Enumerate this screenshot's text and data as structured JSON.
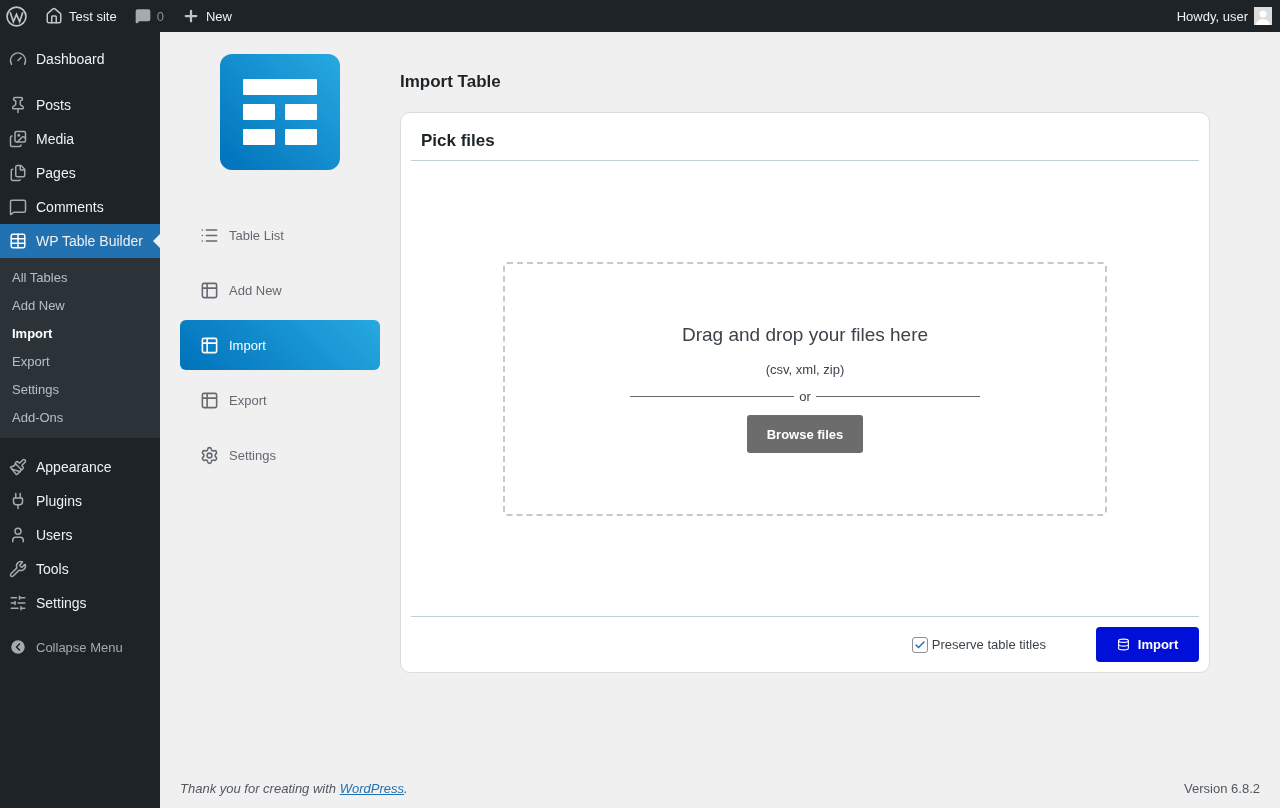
{
  "admin_bar": {
    "site": "Test site",
    "comments": "0",
    "new": "New",
    "greeting": "Howdy, user"
  },
  "sidebar": {
    "groups": [
      [
        {
          "label": "Dashboard",
          "selected": false
        }
      ],
      [
        {
          "label": "Posts",
          "selected": false
        },
        {
          "label": "Media",
          "selected": false
        },
        {
          "label": "Pages",
          "selected": false
        },
        {
          "label": "Comments",
          "selected": false
        },
        {
          "label": "WP Table Builder",
          "selected": true,
          "children": [
            {
              "label": "All Tables",
              "selected": false
            },
            {
              "label": "Add New",
              "selected": false
            },
            {
              "label": "Import",
              "selected": true
            },
            {
              "label": "Export",
              "selected": false
            },
            {
              "label": "Settings",
              "selected": false
            },
            {
              "label": "Add-Ons",
              "selected": false
            }
          ]
        }
      ],
      [
        {
          "label": "Appearance",
          "selected": false
        },
        {
          "label": "Plugins",
          "selected": false
        },
        {
          "label": "Users",
          "selected": false
        },
        {
          "label": "Tools",
          "selected": false
        },
        {
          "label": "Settings",
          "selected": false
        }
      ]
    ],
    "collapse": "Collapse Menu"
  },
  "plugin_nav": [
    {
      "label": "Table List",
      "selected": false
    },
    {
      "label": "Add New",
      "selected": false
    },
    {
      "label": "Import",
      "selected": true
    },
    {
      "label": "Export",
      "selected": false
    },
    {
      "label": "Settings",
      "selected": false
    }
  ],
  "page_title": "Import Table",
  "card": {
    "heading": "Pick files",
    "dropzone": {
      "title": "Drag and drop your files here",
      "hint": "(csv, xml, zip)",
      "separator": "or",
      "button": "Browse files"
    },
    "preserve_titles": {
      "label": "Preserve table titles",
      "checked": true
    },
    "import_button": "Import"
  },
  "footer": {
    "thanks": "Thank you for creating with",
    "link": "WordPress",
    "end": ".",
    "version": "Version 6.8.2"
  }
}
